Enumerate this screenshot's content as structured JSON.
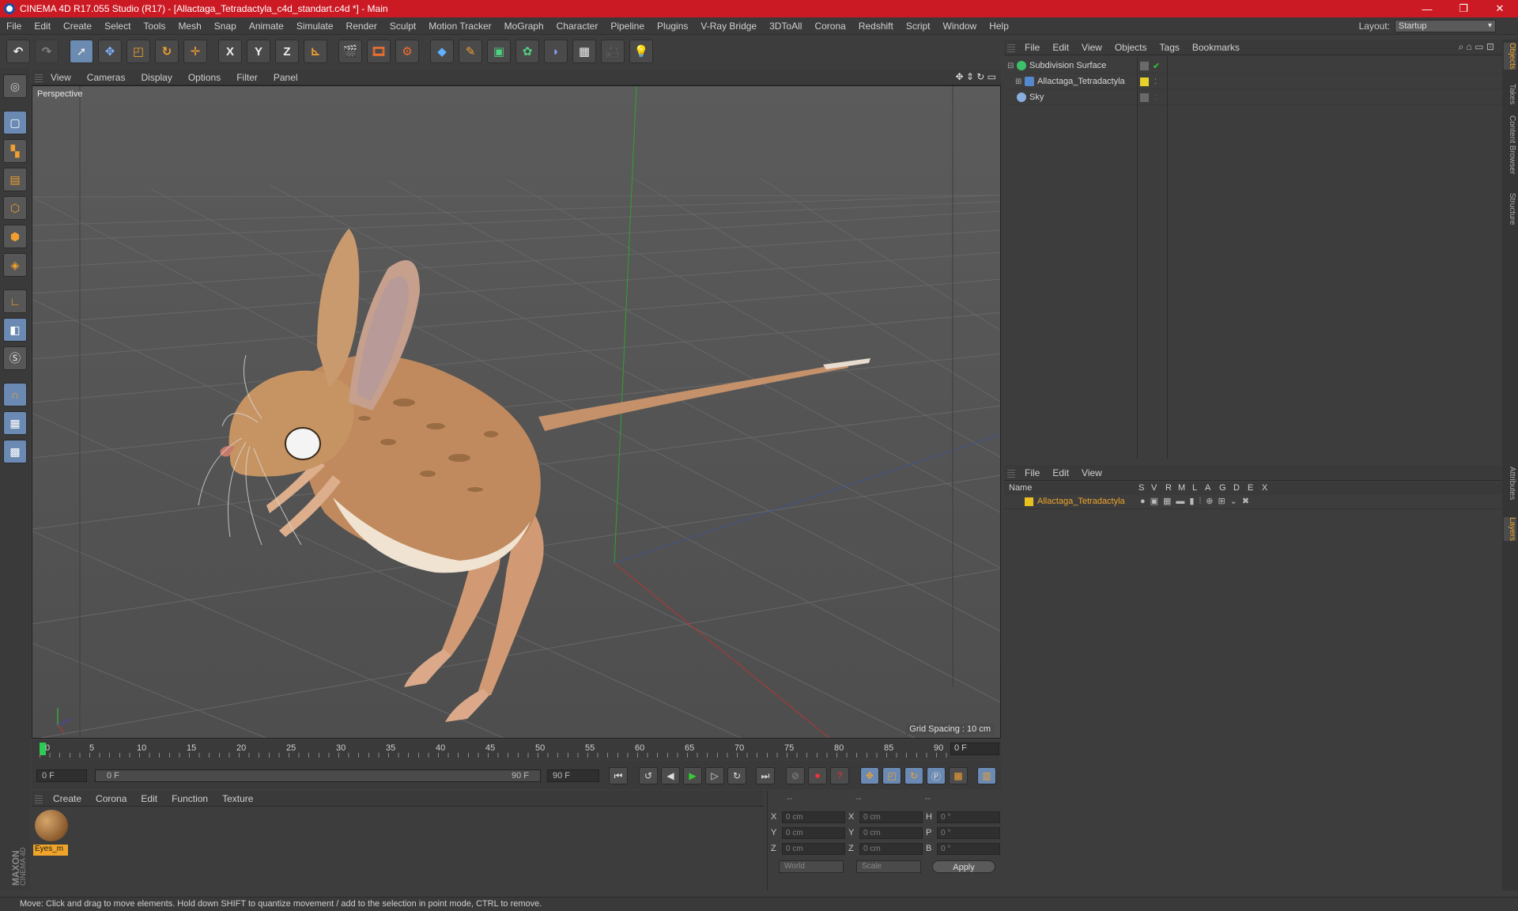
{
  "window": {
    "title": "CINEMA 4D R17.055 Studio (R17) - [Allactaga_Tetradactyla_c4d_standart.c4d *] - Main",
    "controls": [
      "—",
      "❐",
      "✕"
    ]
  },
  "menubar": {
    "items": [
      "File",
      "Edit",
      "Create",
      "Select",
      "Tools",
      "Mesh",
      "Snap",
      "Animate",
      "Simulate",
      "Render",
      "Sculpt",
      "Motion Tracker",
      "MoGraph",
      "Character",
      "Pipeline",
      "Plugins",
      "V-Ray Bridge",
      "3DToAll",
      "Corona",
      "Redshift",
      "Script",
      "Window",
      "Help"
    ],
    "layout_label": "Layout:",
    "layout_value": "Startup"
  },
  "toolbar": {
    "axis_x": "X",
    "axis_y": "Y",
    "axis_z": "Z"
  },
  "viewport": {
    "menu": [
      "View",
      "Cameras",
      "Display",
      "Options",
      "Filter",
      "Panel"
    ],
    "label": "Perspective",
    "grid_spacing": "Grid Spacing : 10 cm"
  },
  "timeline": {
    "ticks": [
      "0",
      "5",
      "10",
      "15",
      "20",
      "25",
      "30",
      "35",
      "40",
      "45",
      "50",
      "55",
      "60",
      "65",
      "70",
      "75",
      "80",
      "85",
      "90"
    ],
    "current_frame": "0 F"
  },
  "playback": {
    "start_field": "0 F",
    "range_start": "0 F",
    "range_end": "90 F",
    "end_field": "90 F"
  },
  "material_panel": {
    "menu": [
      "Create",
      "Corona",
      "Edit",
      "Function",
      "Texture"
    ],
    "materials": [
      {
        "name": "Eyes_m"
      }
    ]
  },
  "coords": {
    "headers": [
      "--",
      "--",
      "--"
    ],
    "rows": [
      {
        "a": "X",
        "av": "0 cm",
        "b": "X",
        "bv": "0 cm",
        "c": "H",
        "cv": "0 °"
      },
      {
        "a": "Y",
        "av": "0 cm",
        "b": "Y",
        "bv": "0 cm",
        "c": "P",
        "cv": "0 °"
      },
      {
        "a": "Z",
        "av": "0 cm",
        "b": "Z",
        "bv": "0 cm",
        "c": "B",
        "cv": "0 °"
      }
    ],
    "coord_system": "World",
    "mode": "Scale",
    "apply_label": "Apply"
  },
  "object_manager": {
    "menu": [
      "File",
      "Edit",
      "View",
      "Objects",
      "Tags",
      "Bookmarks"
    ],
    "objects": [
      {
        "name": "Subdivision Surface"
      },
      {
        "name": "Allactaga_Tetradactyla"
      },
      {
        "name": "Sky"
      }
    ]
  },
  "layer_manager": {
    "menu": [
      "File",
      "Edit",
      "View"
    ],
    "columns": [
      "Name",
      "S",
      "V",
      "R",
      "M",
      "L",
      "A",
      "G",
      "D",
      "E",
      "X"
    ],
    "layers": [
      {
        "name": "Allactaga_Tetradactyla",
        "color": "#e8c020"
      }
    ]
  },
  "side_tabs": [
    "Objects",
    "Takes",
    "Content Browser",
    "Structure",
    "Attributes",
    "Layers"
  ],
  "status": "Move: Click and drag to move elements. Hold down SHIFT to quantize movement / add to the selection in point mode, CTRL to remove.",
  "logo": "MAXON CINEMA 4D"
}
